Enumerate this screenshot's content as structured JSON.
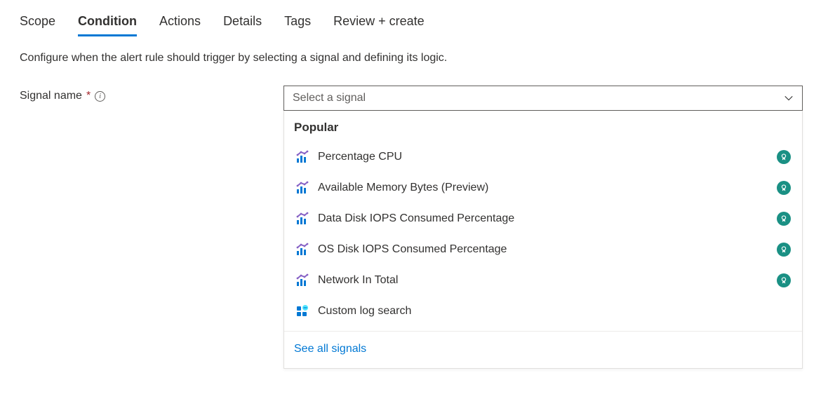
{
  "tabs": {
    "scope": "Scope",
    "condition": "Condition",
    "actions": "Actions",
    "details": "Details",
    "tags": "Tags",
    "review": "Review + create"
  },
  "description": "Configure when the alert rule should trigger by selecting a signal and defining its logic.",
  "form": {
    "signal_name_label": "Signal name",
    "signal_placeholder": "Select a signal"
  },
  "dropdown": {
    "section_header": "Popular",
    "signals": [
      {
        "label": "Percentage CPU",
        "icon": "metric",
        "badge": true
      },
      {
        "label": "Available Memory Bytes (Preview)",
        "icon": "metric",
        "badge": true
      },
      {
        "label": "Data Disk IOPS Consumed Percentage",
        "icon": "metric",
        "badge": true
      },
      {
        "label": "OS Disk IOPS Consumed Percentage",
        "icon": "metric",
        "badge": true
      },
      {
        "label": "Network In Total",
        "icon": "metric",
        "badge": true
      },
      {
        "label": "Custom log search",
        "icon": "log",
        "badge": false
      }
    ],
    "see_all": "See all signals"
  }
}
